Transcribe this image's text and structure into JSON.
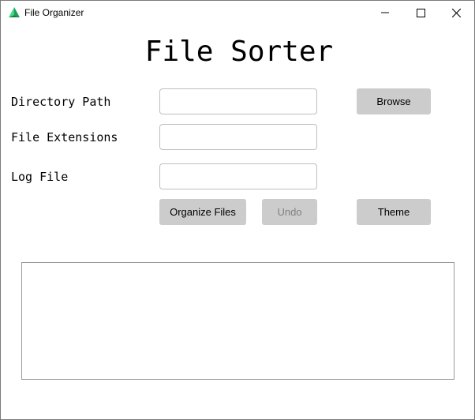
{
  "window": {
    "title": "File Organizer",
    "app_icon": "pyqt-leaf-icon",
    "controls": {
      "minimize_icon": "minimize-icon",
      "maximize_icon": "maximize-icon",
      "close_icon": "close-icon"
    }
  },
  "main": {
    "heading": "File Sorter",
    "fields": {
      "directory": {
        "label": "Directory Path",
        "value": "",
        "placeholder": ""
      },
      "extensions": {
        "label": "File Extensions",
        "value": "",
        "placeholder": ""
      },
      "log_file": {
        "label": "Log File",
        "value": "",
        "placeholder": ""
      }
    },
    "buttons": {
      "browse": "Browse",
      "organize": "Organize Files",
      "undo": "Undo",
      "theme": "Theme"
    },
    "log_output": ""
  },
  "colors": {
    "button_bg": "#cccccc",
    "disabled_text": "#7f7f7f",
    "icon_green": "#2ecc71"
  }
}
